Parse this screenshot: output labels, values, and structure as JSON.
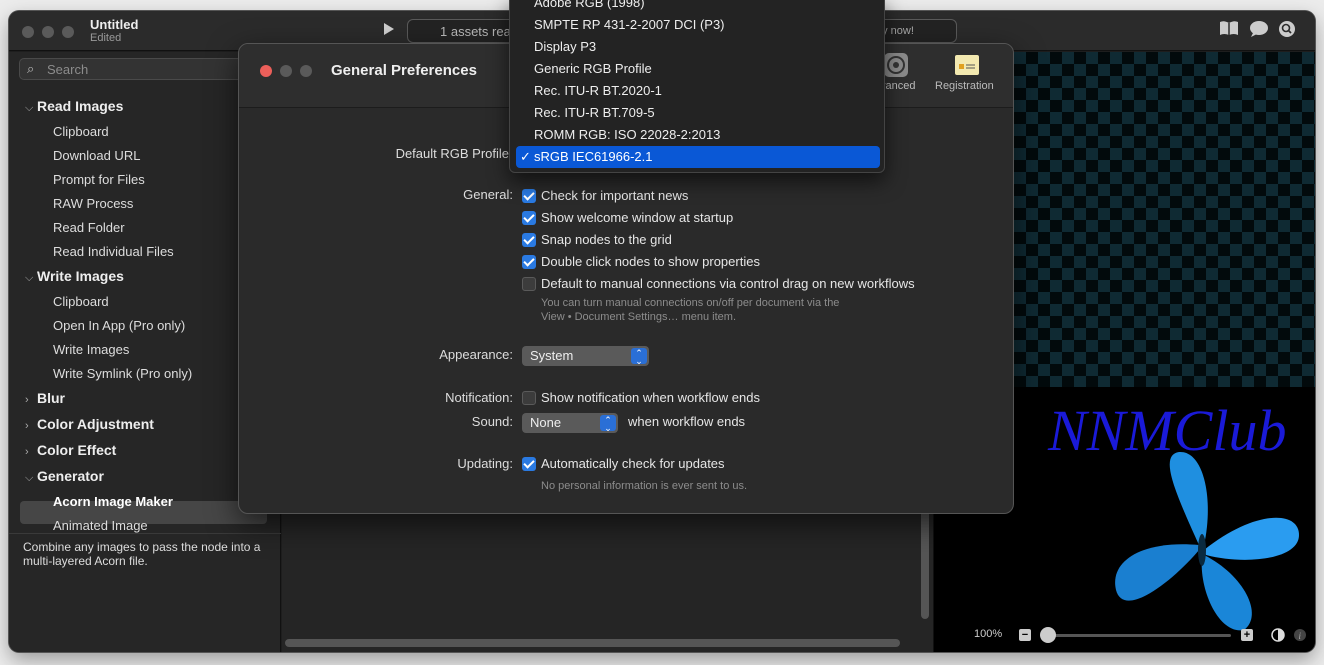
{
  "window": {
    "title": "Untitled",
    "subtitle": "Edited"
  },
  "toolbar": {
    "status_text": "1 assets rea",
    "buy_text": "uy now!"
  },
  "icons": {
    "book": "book-icon",
    "chat": "chat-bubble-icon",
    "search": "search-icon",
    "play": "play-icon"
  },
  "sidebar": {
    "search_placeholder": "Search",
    "groups": {
      "read": {
        "label": "Read Images",
        "items": [
          "Clipboard",
          "Download URL",
          "Prompt for Files",
          "RAW Process",
          "Read Folder",
          "Read Individual Files"
        ]
      },
      "write": {
        "label": "Write Images",
        "items": [
          "Clipboard",
          "Open In App (Pro only)",
          "Write Images",
          "Write Symlink (Pro only)"
        ]
      },
      "blur": {
        "label": "Blur"
      },
      "color_adjustment": {
        "label": "Color Adjustment"
      },
      "color_effect": {
        "label": "Color Effect"
      },
      "generator": {
        "label": "Generator",
        "items": [
          "Acorn Image Maker",
          "Animated Image"
        ]
      }
    },
    "selected_item": "Acorn Image Maker",
    "description": "Combine any images to pass the node into a multi-layered Acorn file."
  },
  "preview": {
    "logo_text": "NNMClub",
    "zoom": "100%"
  },
  "prefs": {
    "title": "General Preferences",
    "toolbar": {
      "advanced_label": "vanced",
      "registration_label": "Registration"
    },
    "default_rgb_label": "Default RGB Profile",
    "general_label": "General:",
    "checks": [
      {
        "label": "Check for important news",
        "checked": true
      },
      {
        "label": "Show welcome window at startup",
        "checked": true
      },
      {
        "label": "Snap nodes to the grid",
        "checked": true
      },
      {
        "label": "Double click nodes to show properties",
        "checked": true
      },
      {
        "label": "Default to manual connections via control drag on new workflows",
        "checked": false
      }
    ],
    "manual_note_1": "You can turn manual connections on/off per document via the",
    "manual_note_2": "View • Document Settings… menu item.",
    "appearance_label": "Appearance:",
    "appearance_value": "System",
    "notification_label": "Notification:",
    "notification_check": "Show notification when workflow ends",
    "notification_checked": false,
    "sound_label": "Sound:",
    "sound_value": "None",
    "sound_suffix": "when workflow ends",
    "updating_label": "Updating:",
    "updating_check": "Automatically check for updates",
    "updating_checked": true,
    "updating_note": "No personal information is ever sent to us."
  },
  "profile_menu": {
    "items": [
      "Adobe RGB (1998)",
      "SMPTE RP 431-2-2007 DCI (P3)",
      "Display P3",
      "Generic RGB Profile",
      "Rec. ITU-R BT.2020-1",
      "Rec. ITU-R BT.709-5",
      "ROMM RGB: ISO 22028-2:2013"
    ],
    "selected": "sRGB IEC61966-2.1",
    "check_mark": "✓"
  },
  "colors": {
    "accent": "#0a58d6",
    "checkbox": "#2a7ae2",
    "close": "#ec5f5a",
    "logo": "#1a1ad8",
    "butterfly": "#1f8fe0"
  }
}
